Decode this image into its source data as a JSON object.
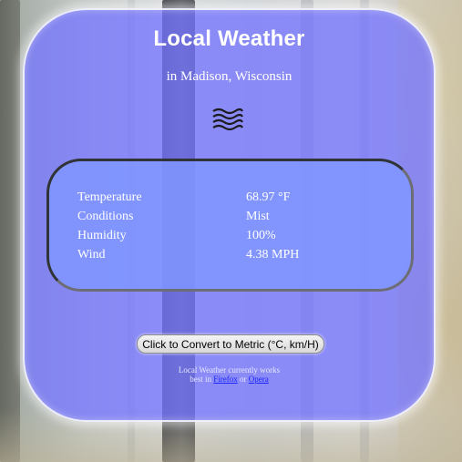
{
  "header": {
    "title": "Local Weather",
    "location": "in Madison, Wisconsin"
  },
  "condition_icon": "mist-waves-icon",
  "readings": [
    {
      "label": "Temperature",
      "value": "68.97 °F"
    },
    {
      "label": "Conditions",
      "value": "Mist"
    },
    {
      "label": "Humidity",
      "value": "100%"
    },
    {
      "label": "Wind",
      "value": "4.38 MPH"
    }
  ],
  "convert_button_label": "Click to Convert to Metric (°C, km/H)",
  "footer": {
    "line1": "Local Weather currently works",
    "prefix": "best in",
    "link1": "Firefox",
    "conjunction": "or",
    "link2": "Opera"
  },
  "colors": {
    "widget_bg": "#7676ff",
    "panel_bg": "#8096ff",
    "link": "#1a24ff",
    "text": "#ffffff"
  }
}
